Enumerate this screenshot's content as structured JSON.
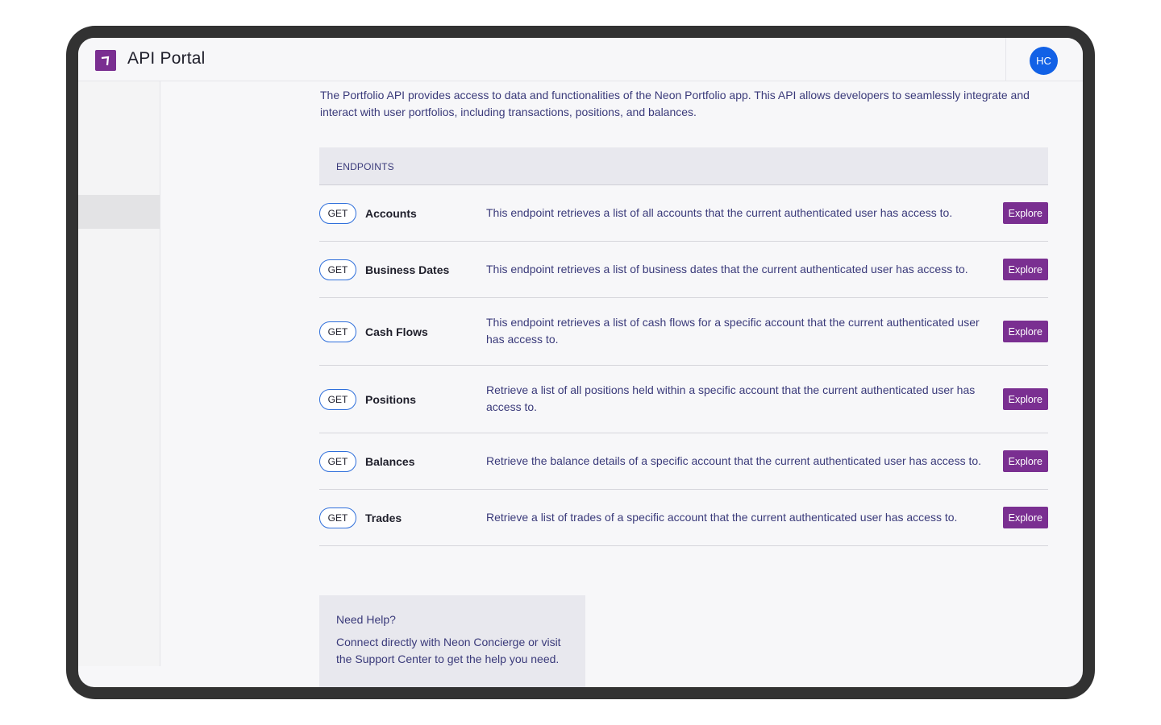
{
  "header": {
    "app_title": "API Portal",
    "avatar_initials": "HC",
    "logo_icon": "arrow-up-right-icon",
    "brand_color": "#7a2f91",
    "avatar_color": "#1261e6"
  },
  "intro": {
    "text": "The Portfolio API provides access to data and functionalities of the Neon Portfolio app. This API allows developers to seamlessly integrate and interact with user portfolios, including transactions, positions, and balances."
  },
  "endpoints": {
    "header": "ENDPOINTS",
    "items": [
      {
        "method": "GET",
        "name": "Accounts",
        "description": "This endpoint retrieves a list of all accounts that the current authenticated user has access to.",
        "action": "Explore"
      },
      {
        "method": "GET",
        "name": "Business Dates",
        "description": "This endpoint retrieves a list of business dates that the current authenticated user has access to.",
        "action": "Explore"
      },
      {
        "method": "GET",
        "name": "Cash Flows",
        "description": "This endpoint retrieves a list of cash flows for a specific account that the current authenticated user has access to.",
        "action": "Explore"
      },
      {
        "method": "GET",
        "name": "Positions",
        "description": "Retrieve a list of all positions held within a specific account that the current authenticated user has access to.",
        "action": "Explore"
      },
      {
        "method": "GET",
        "name": "Balances",
        "description": "Retrieve the balance details of a specific account that the current authenticated user has access to.",
        "action": "Explore"
      },
      {
        "method": "GET",
        "name": "Trades",
        "description": "Retrieve a list of trades of a specific account that the current authenticated user has access to.",
        "action": "Explore"
      }
    ]
  },
  "help": {
    "title": "Need Help?",
    "text": "Connect directly with Neon Concierge or visit the Support Center to get the help you need."
  }
}
